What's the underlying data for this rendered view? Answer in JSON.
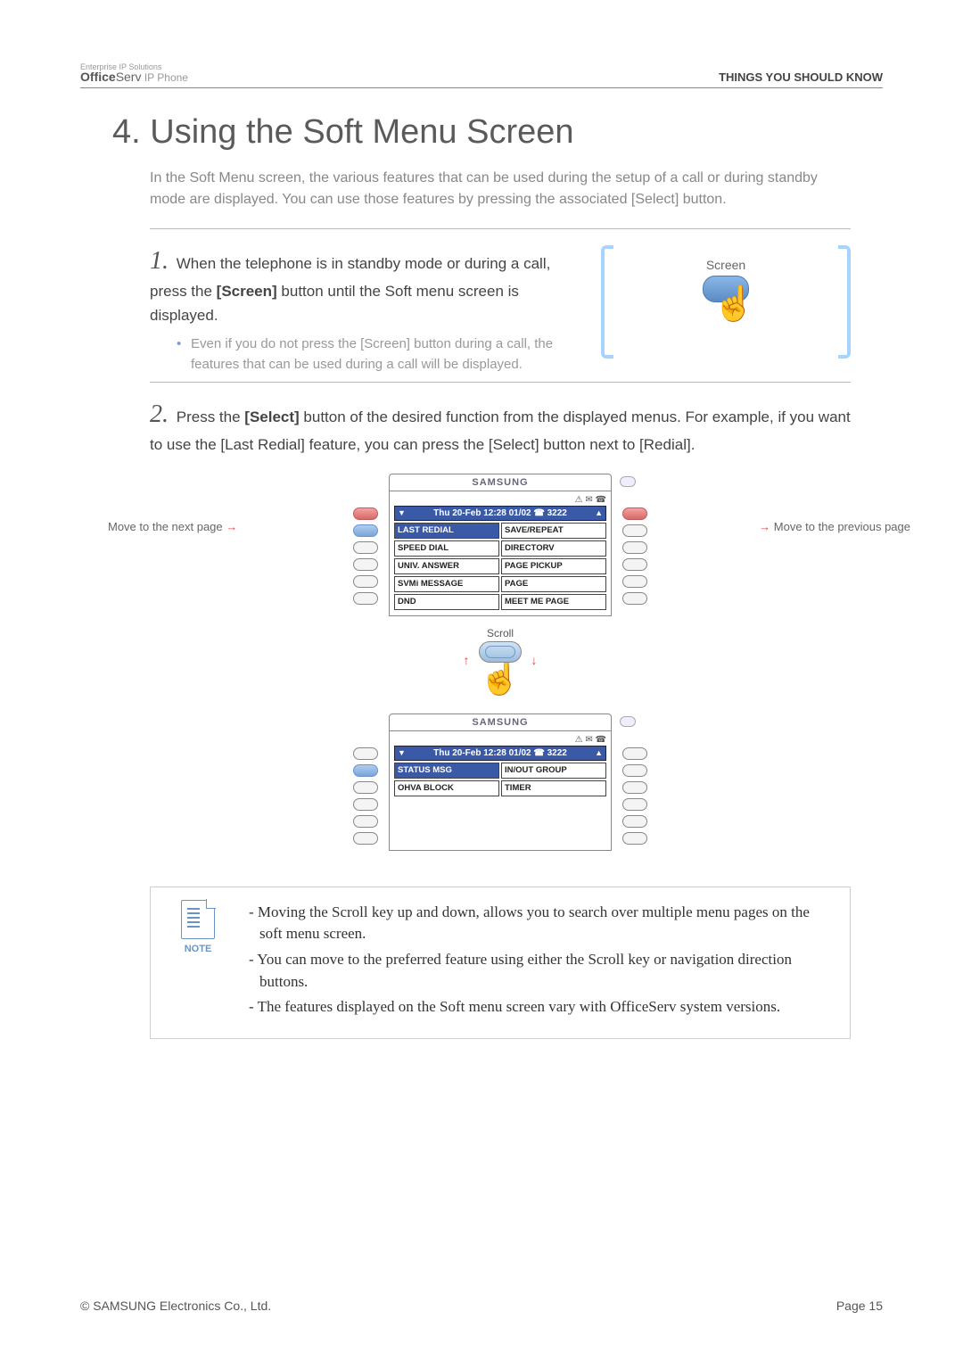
{
  "header": {
    "brand_tag": "Enterprise IP Solutions",
    "brand_office": "Office",
    "brand_serv": "Serv",
    "brand_ip": " IP Phone",
    "section": "THINGS YOU SHOULD KNOW"
  },
  "title": "4. Using the Soft Menu Screen",
  "intro": "In the Soft Menu screen, the various features that can be used during the setup of a call or during standby mode are displayed. You can use those features by pressing the associated [Select] button.",
  "step1": {
    "num": "1.",
    "text_a": "When the telephone is in standby mode or during a call, press the ",
    "text_bold": "[Screen]",
    "text_b": " button until the Soft menu screen is displayed.",
    "bullet": "Even if you do not press the [Screen] button during a call, the features that can be used during a call will be displayed.",
    "screen_label": "Screen"
  },
  "step2": {
    "num": "2.",
    "text_a": "Press the ",
    "text_bold": "[Select]",
    "text_b": " button of the desired function from the displayed menus. For example, if you want to use the [Last Redial] feature, you can press the [Select] button next to [Redial]."
  },
  "callouts": {
    "next_page": "Move to the next page",
    "prev_page": "Move to the previous page",
    "scroll": "Scroll"
  },
  "phone1": {
    "brand": "SAMSUNG",
    "icons": "⚠ ✉ ☎",
    "date": "Thu 20-Feb 12:28  01/02 ☎ 3222",
    "menu": [
      {
        "l": "LAST REDIAL",
        "r": "SAVE/REPEAT",
        "hl": true
      },
      {
        "l": "SPEED DIAL",
        "r": "DIRECTORV"
      },
      {
        "l": "UNIV. ANSWER",
        "r": "PAGE PICKUP"
      },
      {
        "l": "SVMi MESSAGE",
        "r": "PAGE"
      },
      {
        "l": "DND",
        "r": "MEET ME PAGE"
      }
    ]
  },
  "phone2": {
    "brand": "SAMSUNG",
    "icons": "⚠ ✉ ☎",
    "date": "Thu 20-Feb 12:28  01/02 ☎ 3222",
    "menu": [
      {
        "l": "STATUS MSG",
        "r": "IN/OUT GROUP",
        "hl": true
      },
      {
        "l": "OHVA BLOCK",
        "r": "TIMER"
      },
      {
        "l": "",
        "r": ""
      },
      {
        "l": "",
        "r": ""
      },
      {
        "l": "",
        "r": ""
      }
    ]
  },
  "note": {
    "label": "NOTE",
    "items": [
      "- Moving the Scroll key up and down, allows you to search over multiple menu pages on the soft menu screen.",
      "- You can move to the preferred feature  using either the Scroll key or navigation direction buttons.",
      "- The features displayed on the Soft menu screen vary with OfficeServ system versions."
    ]
  },
  "footer": {
    "copyright": "© SAMSUNG Electronics Co., Ltd.",
    "page": "Page 15"
  }
}
